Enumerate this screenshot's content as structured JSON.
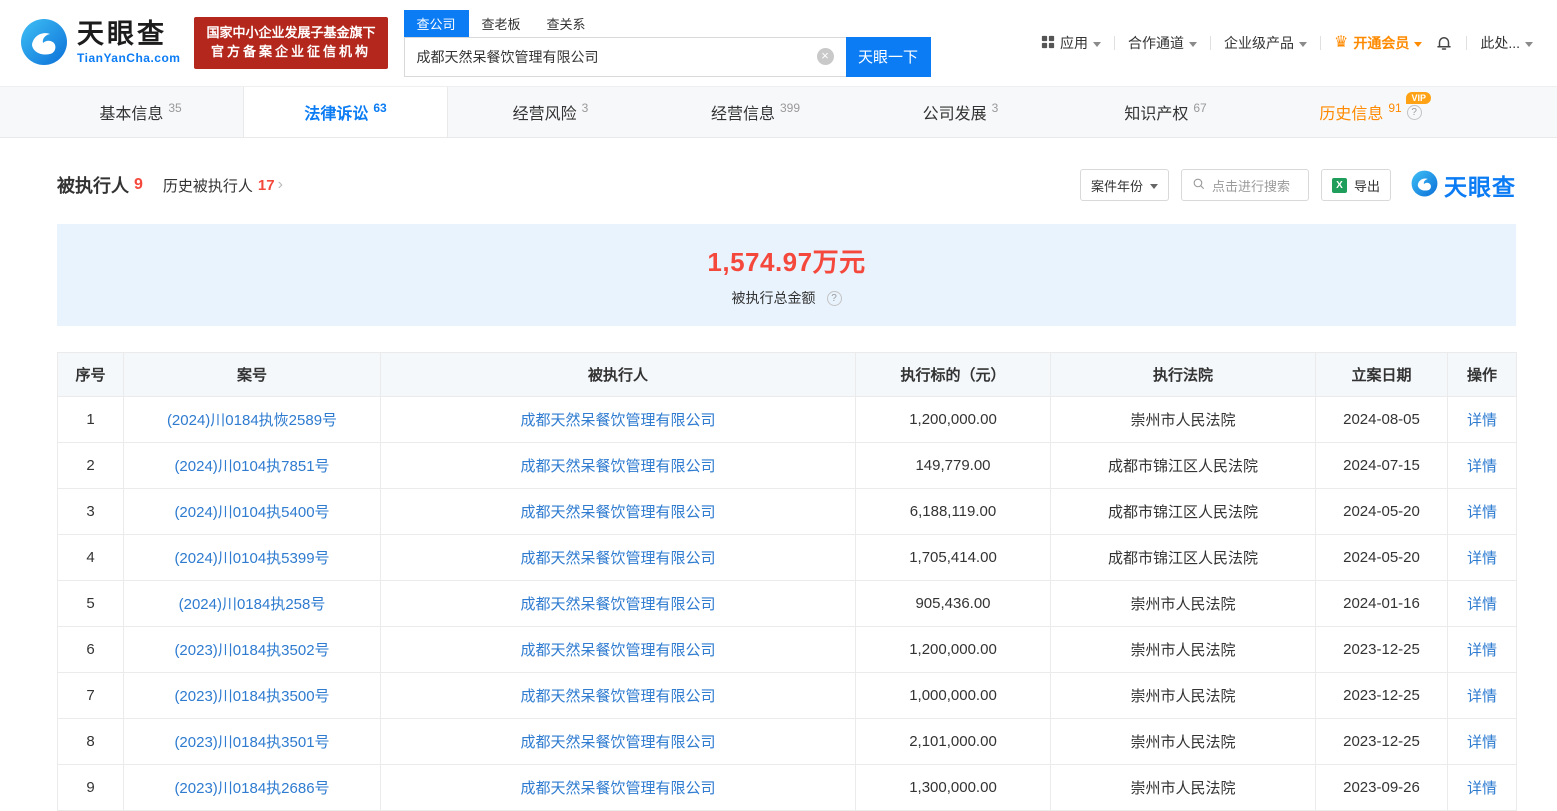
{
  "colors": {
    "brand_blue": "#0b7cf4",
    "link_blue": "#2e7bd0",
    "alert_red": "#f5483c",
    "vip_orange": "#ff8a00",
    "badge_red": "#b4271d"
  },
  "header": {
    "logo": {
      "brand": "天眼查",
      "domain": "TianYanCha.com"
    },
    "badge": {
      "line1": "国家中小企业发展子基金旗下",
      "line2": "官方备案企业征信机构"
    },
    "search_tabs": [
      {
        "label": "查公司",
        "active": true
      },
      {
        "label": "查老板",
        "active": false
      },
      {
        "label": "查关系",
        "active": false
      }
    ],
    "search": {
      "value": "成都天然呆餐饮管理有限公司",
      "button": "天眼一下"
    },
    "nav": [
      {
        "label": "应用"
      },
      {
        "label": "合作通道"
      },
      {
        "label": "企业级产品"
      },
      {
        "label": "开通会员"
      },
      {
        "label": "此处..."
      }
    ]
  },
  "tabs": [
    {
      "label": "基本信息",
      "count": "35"
    },
    {
      "label": "法律诉讼",
      "count": "63",
      "active": true
    },
    {
      "label": "经营风险",
      "count": "3"
    },
    {
      "label": "经营信息",
      "count": "399"
    },
    {
      "label": "公司发展",
      "count": "3"
    },
    {
      "label": "知识产权",
      "count": "67"
    },
    {
      "label": "历史信息",
      "count": "91",
      "vip_badge": "VIP"
    }
  ],
  "section": {
    "title": "被执行人",
    "title_count": "9",
    "history_label": "历史被执行人",
    "history_count": "17",
    "toolbar": {
      "year_filter": "案件年份",
      "search_placeholder": "点击进行搜索",
      "export_label": "导出",
      "watermark": "天眼查"
    }
  },
  "summary": {
    "amount": "1,574.97万元",
    "label": "被执行总金额"
  },
  "table": {
    "columns": [
      "序号",
      "案号",
      "被执行人",
      "执行标的（元）",
      "执行法院",
      "立案日期",
      "操作"
    ],
    "detail_label": "详情",
    "rows": [
      {
        "no": "1",
        "case": "(2024)川0184执恢2589号",
        "person": "成都天然呆餐饮管理有限公司",
        "amount": "1,200,000.00",
        "court": "崇州市人民法院",
        "date": "2024-08-05"
      },
      {
        "no": "2",
        "case": "(2024)川0104执7851号",
        "person": "成都天然呆餐饮管理有限公司",
        "amount": "149,779.00",
        "court": "成都市锦江区人民法院",
        "date": "2024-07-15"
      },
      {
        "no": "3",
        "case": "(2024)川0104执5400号",
        "person": "成都天然呆餐饮管理有限公司",
        "amount": "6,188,119.00",
        "court": "成都市锦江区人民法院",
        "date": "2024-05-20"
      },
      {
        "no": "4",
        "case": "(2024)川0104执5399号",
        "person": "成都天然呆餐饮管理有限公司",
        "amount": "1,705,414.00",
        "court": "成都市锦江区人民法院",
        "date": "2024-05-20"
      },
      {
        "no": "5",
        "case": "(2024)川0184执258号",
        "person": "成都天然呆餐饮管理有限公司",
        "amount": "905,436.00",
        "court": "崇州市人民法院",
        "date": "2024-01-16"
      },
      {
        "no": "6",
        "case": "(2023)川0184执3502号",
        "person": "成都天然呆餐饮管理有限公司",
        "amount": "1,200,000.00",
        "court": "崇州市人民法院",
        "date": "2023-12-25"
      },
      {
        "no": "7",
        "case": "(2023)川0184执3500号",
        "person": "成都天然呆餐饮管理有限公司",
        "amount": "1,000,000.00",
        "court": "崇州市人民法院",
        "date": "2023-12-25"
      },
      {
        "no": "8",
        "case": "(2023)川0184执3501号",
        "person": "成都天然呆餐饮管理有限公司",
        "amount": "2,101,000.00",
        "court": "崇州市人民法院",
        "date": "2023-12-25"
      },
      {
        "no": "9",
        "case": "(2023)川0184执2686号",
        "person": "成都天然呆餐饮管理有限公司",
        "amount": "1,300,000.00",
        "court": "崇州市人民法院",
        "date": "2023-09-26"
      }
    ]
  }
}
